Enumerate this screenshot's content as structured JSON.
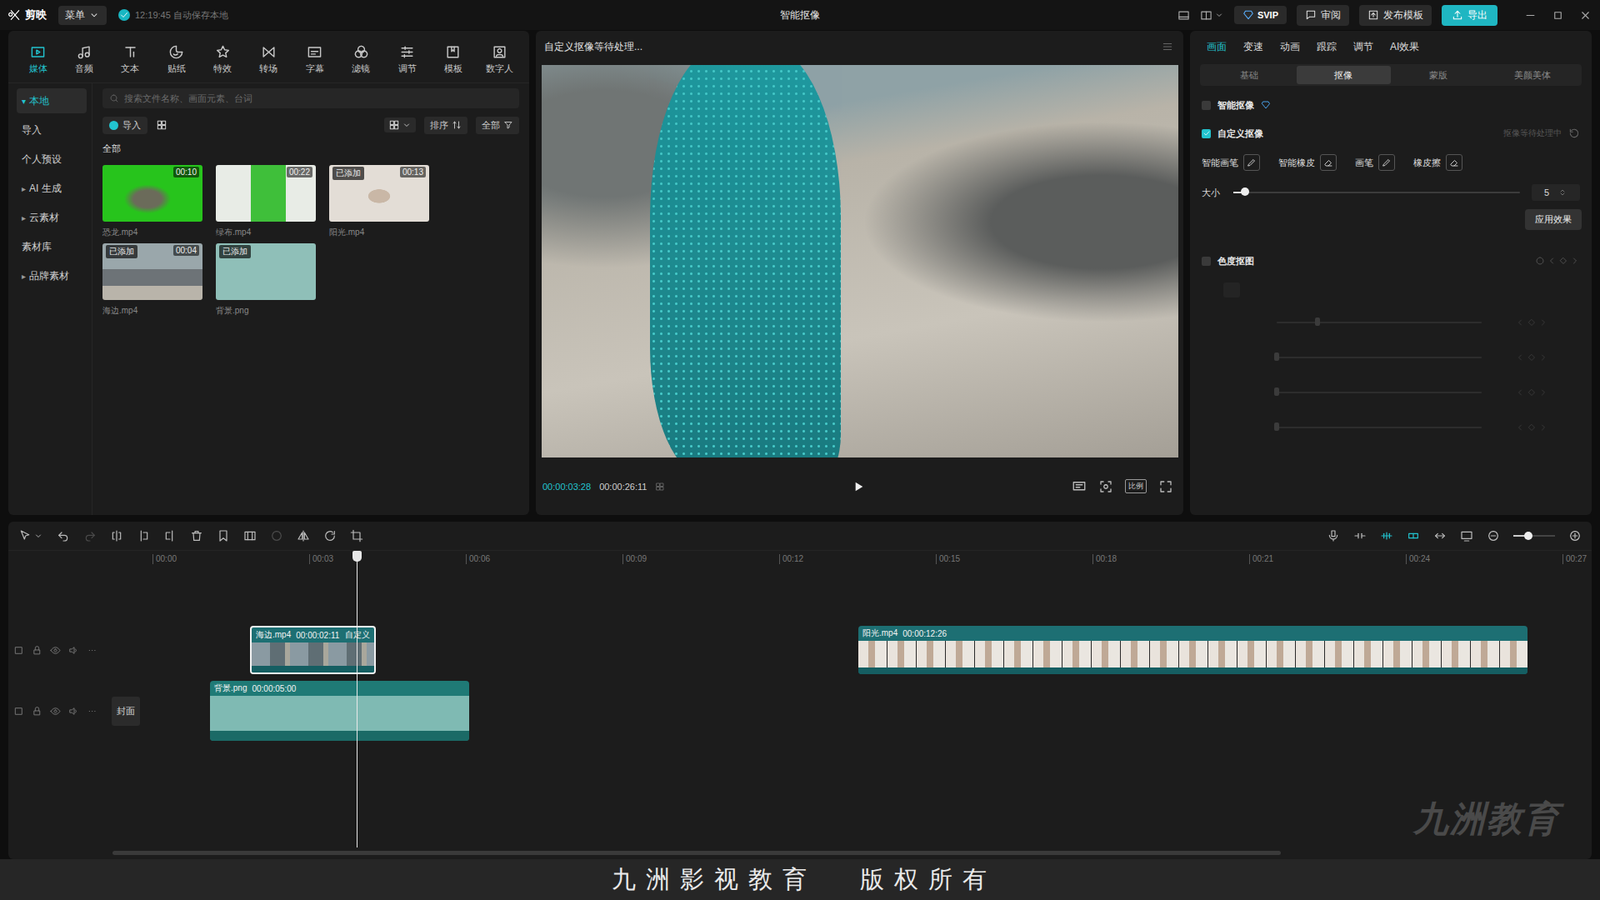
{
  "app": {
    "logo": "剪映",
    "menu": "菜单",
    "save_status": "12:19:45 自动保存本地",
    "title": "智能抠像",
    "svip": "SVIP",
    "review": "审阅",
    "publish": "发布模板",
    "export": "导出"
  },
  "media_tabs": [
    {
      "label": "媒体",
      "selected": true
    },
    {
      "label": "音频",
      "selected": false
    },
    {
      "label": "文本",
      "selected": false
    },
    {
      "label": "贴纸",
      "selected": false
    },
    {
      "label": "特效",
      "selected": false
    },
    {
      "label": "转场",
      "selected": false
    },
    {
      "label": "字幕",
      "selected": false
    },
    {
      "label": "滤镜",
      "selected": false
    },
    {
      "label": "调节",
      "selected": false
    },
    {
      "label": "模板",
      "selected": false
    },
    {
      "label": "数字人",
      "selected": false
    }
  ],
  "sidebar": {
    "items": [
      {
        "label": "本地",
        "arrow": "▾",
        "selected": true
      },
      {
        "label": "导入",
        "selected": false
      },
      {
        "label": "个人预设",
        "selected": false
      },
      {
        "label": "AI 生成",
        "arrow": "▸",
        "selected": false
      },
      {
        "label": "云素材",
        "arrow": "▸",
        "selected": false
      },
      {
        "label": "素材库",
        "selected": false
      },
      {
        "label": "品牌素材",
        "arrow": "▸",
        "selected": false
      }
    ]
  },
  "media": {
    "search_placeholder": "搜索文件名称、画面元素、台词",
    "import": "导入",
    "sort": "排序",
    "filter": "全部",
    "section": "全部",
    "added_label": "已添加",
    "items": [
      {
        "name": "恐龙.mp4",
        "duration": "00:10",
        "added": false
      },
      {
        "name": "绿布.mp4",
        "duration": "00:22",
        "added": false
      },
      {
        "name": "阳光.mp4",
        "duration": "00:13",
        "added": true
      },
      {
        "name": "海边.mp4",
        "duration": "00:04",
        "added": true
      },
      {
        "name": "背景.png",
        "added": true
      }
    ]
  },
  "preview": {
    "status": "自定义抠像等待处理...",
    "current_time": "00:00:03:28",
    "total_time": "00:00:26:11",
    "ratio": "比例"
  },
  "inspector": {
    "tabs": [
      {
        "label": "画面",
        "selected": true
      },
      {
        "label": "变速",
        "selected": false
      },
      {
        "label": "动画",
        "selected": false
      },
      {
        "label": "跟踪",
        "selected": false
      },
      {
        "label": "调节",
        "selected": false
      },
      {
        "label": "AI效果",
        "selected": false
      }
    ],
    "subtabs": [
      {
        "label": "基础",
        "selected": false
      },
      {
        "label": "抠像",
        "selected": true
      },
      {
        "label": "蒙版",
        "selected": false
      },
      {
        "label": "美颜美体",
        "selected": false
      }
    ],
    "smart_cutout": {
      "label": "智能抠像",
      "checked": false
    },
    "custom_cutout": {
      "label": "自定义抠像",
      "checked": true,
      "status": "抠像等待处理中"
    },
    "tools": [
      {
        "label": "智能画笔"
      },
      {
        "label": "智能橡皮"
      },
      {
        "label": "画笔"
      },
      {
        "label": "橡皮擦"
      }
    ],
    "size": {
      "label": "大小",
      "level": 0.04,
      "value": "5"
    },
    "apply": "应用效果",
    "chroma": {
      "label": "色度抠图",
      "checked": false,
      "disabled": true,
      "sliders": [
        {
          "level": 0.2
        },
        {
          "level": 0
        },
        {
          "level": 0
        },
        {
          "level": 0
        }
      ]
    }
  },
  "timeline": {
    "history": {
      "undo_enabled": true,
      "redo_enabled": false
    },
    "toggles": [
      {
        "on": false
      },
      {
        "on": true
      },
      {
        "on": true
      },
      {
        "on": false
      }
    ],
    "zoom_level": 0.35,
    "ruler": [
      "00:00",
      "00:03",
      "00:06",
      "00:09",
      "00:12",
      "00:15",
      "00:18",
      "00:21",
      "00:24",
      "00:27"
    ],
    "tracks": [
      {
        "clips": [
          {
            "name": "海边.mp4",
            "duration": "00:00:02:11",
            "tag": "自定义",
            "kind": "video",
            "selected": true
          },
          {
            "name": "阳光.mp4",
            "duration": "00:00:12:26",
            "kind": "video",
            "selected": false
          }
        ]
      },
      {
        "cover": "封面",
        "clips": [
          {
            "name": "背景.png",
            "duration": "00:00:05:00",
            "kind": "image",
            "selected": false
          }
        ]
      }
    ],
    "watermark": "九洲教育"
  },
  "footer": "九 洲 影 视 教 育　　版 权 所 有"
}
